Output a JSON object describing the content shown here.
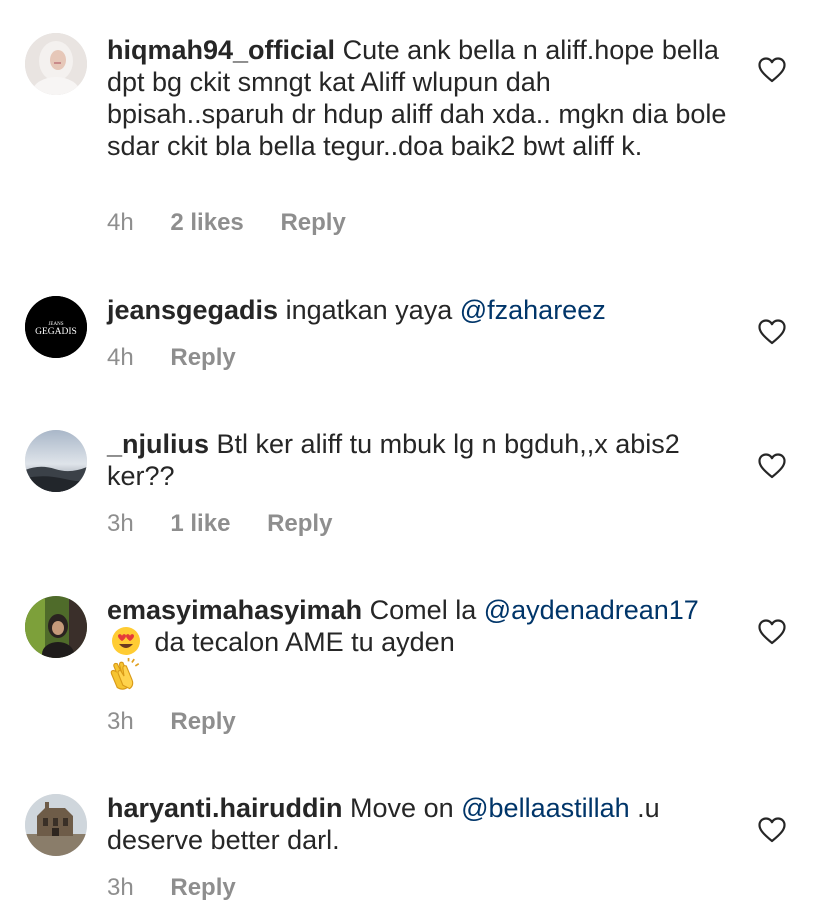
{
  "comments": [
    {
      "username": "hiqmah94_official",
      "text": "Cute ank bella n aliff.hope bella dpt bg ckit smngt kat Aliff wlupun dah bpisah..sparuh dr hdup aliff dah xda.. mgkn dia bole sdar ckit bla bella tegur..doa baik2 bwt aliff k.",
      "time": "4h",
      "likes": "2 likes",
      "reply": "Reply"
    },
    {
      "username": "jeansgegadis",
      "text_before": "ingatkan yaya",
      "mention": "@fzahareez",
      "time": "4h",
      "reply": "Reply",
      "avatar_logo_small": "JEANS",
      "avatar_logo_large": "GEGADIS"
    },
    {
      "username": "_njulius",
      "text": "Btl ker aliff tu mbuk lg n bgduh,,x abis2 ker??",
      "time": "3h",
      "likes": "1 like",
      "reply": "Reply"
    },
    {
      "username": "emasyimahasyimah",
      "text_before": "Comel la",
      "mention": "@aydenadrean17",
      "emoji_1": "heart-eyes-emoji",
      "text_after": "da tecalon AME tu ayden",
      "emoji_2": "clapping-hands-emoji",
      "time": "3h",
      "reply": "Reply"
    },
    {
      "username": "haryanti.hairuddin",
      "text_before": "Move on",
      "mention": "@bellaastillah",
      "text_after": ".u deserve better darl.",
      "time": "3h",
      "reply": "Reply"
    }
  ],
  "colors": {
    "text": "#262626",
    "meta": "#8e8e8e",
    "mention": "#003569",
    "heart_stroke": "#262626"
  }
}
